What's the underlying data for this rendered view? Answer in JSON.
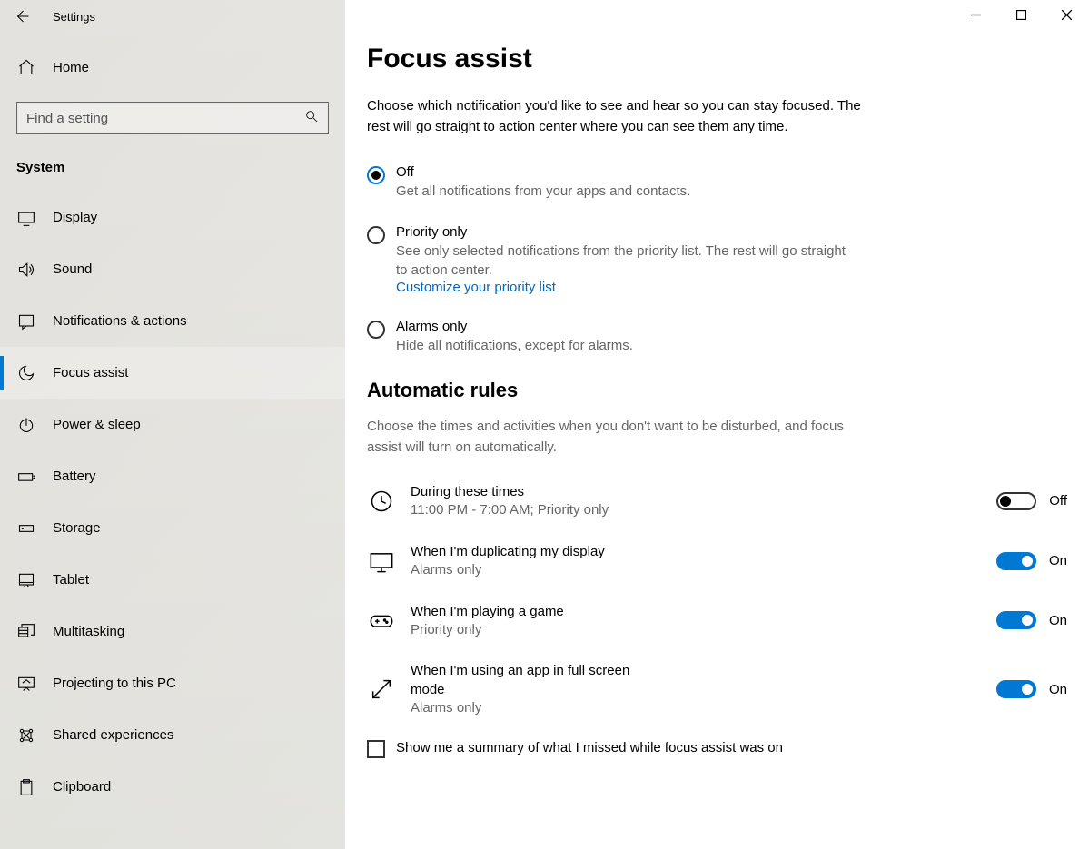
{
  "titlebar": {
    "app_title": "Settings"
  },
  "sidebar": {
    "home_label": "Home",
    "search_placeholder": "Find a setting",
    "section_header": "System",
    "items": [
      {
        "label": "Display"
      },
      {
        "label": "Sound"
      },
      {
        "label": "Notifications & actions"
      },
      {
        "label": "Focus assist"
      },
      {
        "label": "Power & sleep"
      },
      {
        "label": "Battery"
      },
      {
        "label": "Storage"
      },
      {
        "label": "Tablet"
      },
      {
        "label": "Multitasking"
      },
      {
        "label": "Projecting to this PC"
      },
      {
        "label": "Shared experiences"
      },
      {
        "label": "Clipboard"
      }
    ]
  },
  "main": {
    "title": "Focus assist",
    "intro": "Choose which notification you'd like to see and hear so you can stay focused. The rest will go straight to action center where you can see them any time.",
    "options": {
      "off": {
        "label": "Off",
        "desc": "Get all notifications from your apps and contacts."
      },
      "priority": {
        "label": "Priority only",
        "desc": "See only selected notifications from the priority list. The rest will go straight to action center.",
        "link": "Customize your priority list"
      },
      "alarms": {
        "label": "Alarms only",
        "desc": "Hide all notifications, except for alarms."
      }
    },
    "rules": {
      "title": "Automatic rules",
      "intro": "Choose the times and activities when you don't want to be disturbed, and focus assist will turn on automatically.",
      "items": [
        {
          "title": "During these times",
          "sub": "11:00 PM - 7:00 AM; Priority only",
          "state": "Off",
          "on": false
        },
        {
          "title": "When I'm duplicating my display",
          "sub": "Alarms only",
          "state": "On",
          "on": true
        },
        {
          "title": "When I'm playing a game",
          "sub": "Priority only",
          "state": "On",
          "on": true
        },
        {
          "title": "When I'm using an app in full screen mode",
          "sub": "Alarms only",
          "state": "On",
          "on": true
        }
      ]
    },
    "summary_checkbox": "Show me a summary of what I missed while focus assist was on"
  }
}
